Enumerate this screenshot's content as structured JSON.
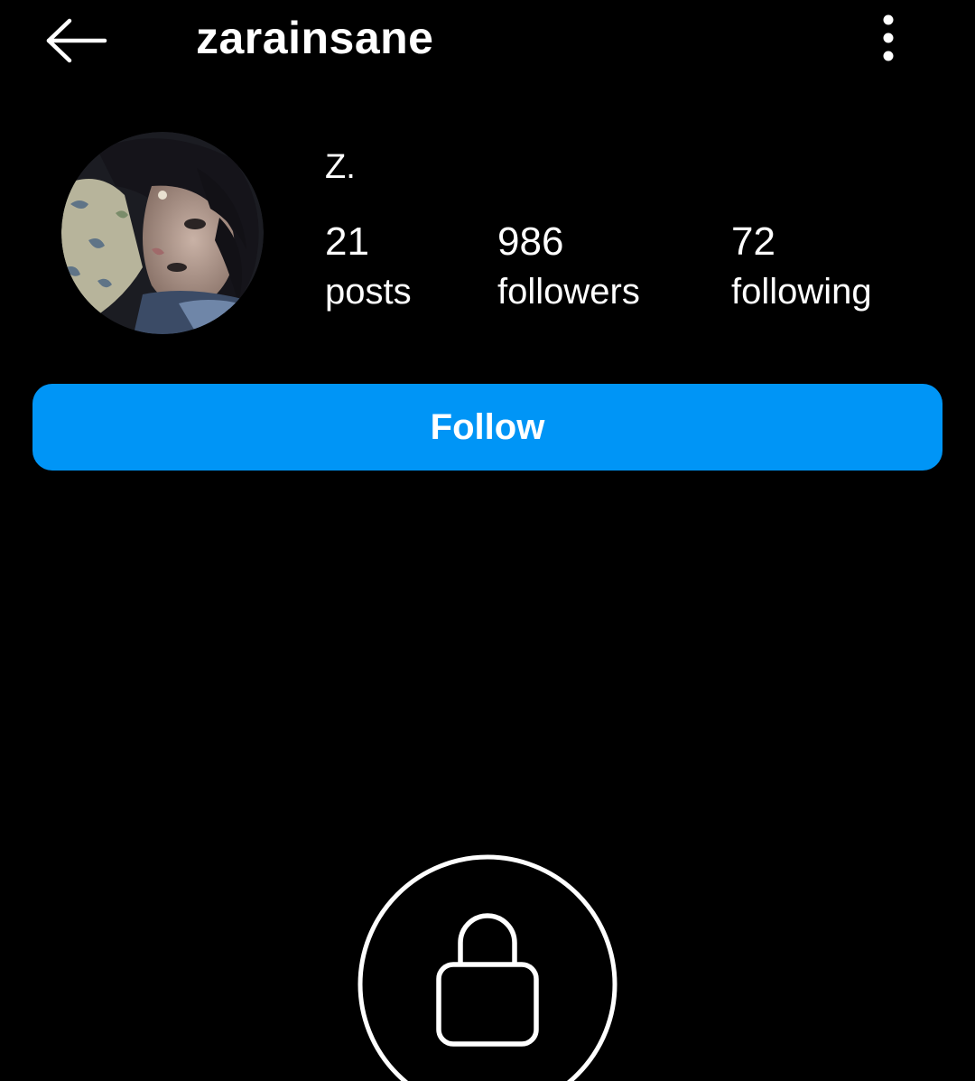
{
  "header": {
    "back_icon": "arrow-left-icon",
    "username": "zarainsane",
    "more_icon": "vertical-ellipsis-icon"
  },
  "profile": {
    "avatar_icon": "profile-photo",
    "display_name": "Z.",
    "stats": {
      "posts": {
        "value": "21",
        "label": "posts"
      },
      "followers": {
        "value": "986",
        "label": "followers"
      },
      "following": {
        "value": "72",
        "label": "following"
      }
    }
  },
  "actions": {
    "follow_label": "Follow"
  },
  "private": {
    "lock_icon": "lock-icon"
  },
  "colors": {
    "background": "#000000",
    "text": "#ffffff",
    "follow_button": "#0095f6"
  }
}
